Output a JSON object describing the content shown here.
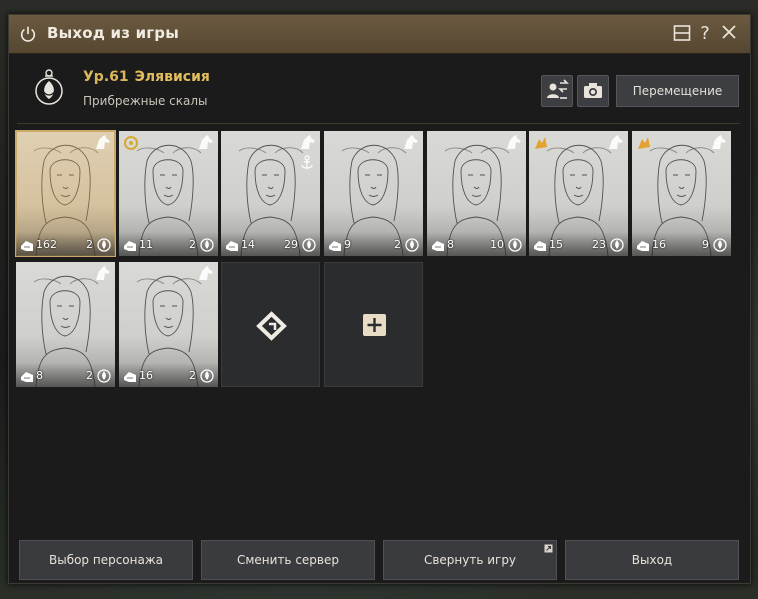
{
  "window": {
    "title": "Выход из игры"
  },
  "header": {
    "level": "Ур.61",
    "name": "Элявисия",
    "location": "Прибрежные скалы",
    "move_label": "Перемещение"
  },
  "characters": [
    {
      "level": "162",
      "count": "2",
      "selected": true
    },
    {
      "level": "11",
      "count": "2"
    },
    {
      "level": "14",
      "count": "29"
    },
    {
      "level": "9",
      "count": "2"
    },
    {
      "level": "8",
      "count": "10"
    },
    {
      "level": "15",
      "count": "23"
    },
    {
      "level": "16",
      "count": "9"
    },
    {
      "level": "8",
      "count": "2"
    },
    {
      "level": "16",
      "count": "2"
    }
  ],
  "footer": {
    "select_character": "Выбор персонажа",
    "change_server": "Сменить сервер",
    "minimize_game": "Свернуть игру",
    "exit": "Выход"
  },
  "colors": {
    "accent_gold": "#e1bd5d",
    "titlebar": "#5f4f38",
    "button_bg": "#3a3b3f"
  }
}
